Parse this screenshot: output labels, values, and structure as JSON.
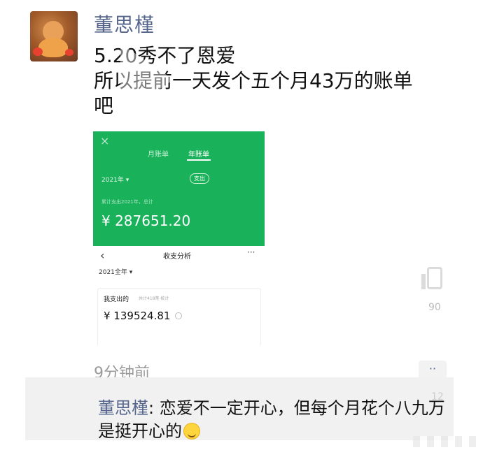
{
  "post": {
    "author": "董思槿",
    "text_line1": "5.20秀不了恩爱",
    "text_line2": "所以提前一天发个五个月43万的账单",
    "text_line3": "吧",
    "timestamp": "9分钟前"
  },
  "media": {
    "tab1": "月账单",
    "tab2": "年账单",
    "year_selector": "2021年 ▾",
    "pill": "支出",
    "green_sub": "累计支出2021年，总计",
    "big_amount": "¥ 287651.20",
    "page_title": "收支分析",
    "year2": "2021全年 ▾",
    "card_label": "我支出的",
    "card_sub": "共计418笔 统计",
    "card_amount": "¥ 139524.81",
    "colors": {
      "accent": "#19b25a"
    }
  },
  "side": {
    "count1": "90",
    "count2": "12"
  },
  "comment": {
    "author": "董思槿",
    "separator": ": ",
    "text": "恋爱不一定开心，但每个月花个八九万是挺开心的",
    "emoji": "smile-emoji"
  },
  "colors": {
    "name": "#55658c",
    "timestamp": "#9a9a9a",
    "comment_bg": "#f1f1f1"
  }
}
